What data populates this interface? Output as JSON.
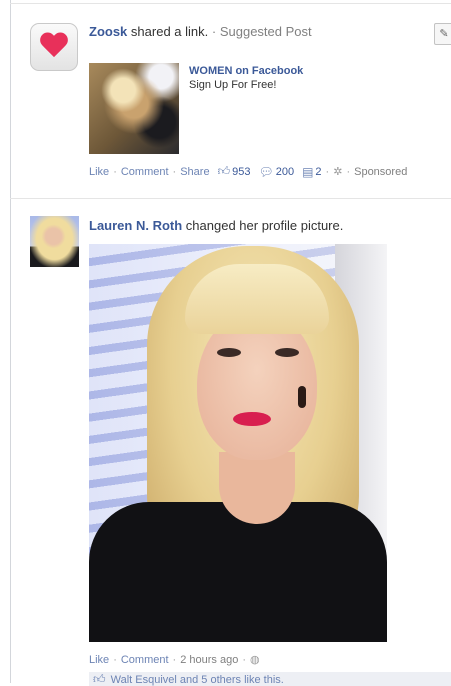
{
  "story1": {
    "actor": "Zoosk",
    "action": "shared a link.",
    "separator": "·",
    "tag": "Suggested Post",
    "link": {
      "title": "WOMEN on Facebook",
      "subtitle": "Sign Up For Free!"
    },
    "actions": {
      "like": "Like",
      "comment": "Comment",
      "share": "Share",
      "like_count": "953",
      "comment_count": "200",
      "share_count": "2",
      "sponsored": "Sponsored"
    }
  },
  "story2": {
    "actor": "Lauren N. Roth",
    "action": "changed her profile picture.",
    "actions": {
      "like": "Like",
      "comment": "Comment",
      "time": "2 hours ago"
    },
    "likes_text": "Walt Esquivel and 5 others like this."
  },
  "icons": {
    "zoosk": "heart-icon",
    "hide": "pencil-icon",
    "like_count": "thumbs-up-icon",
    "comment_count": "comment-bubble-icon",
    "share_count": "share-icon",
    "settings": "gear-icon",
    "audience": "globe-icon"
  },
  "colors": {
    "link": "#3b5998",
    "action_link": "#6d84b4",
    "muted": "#808080"
  }
}
